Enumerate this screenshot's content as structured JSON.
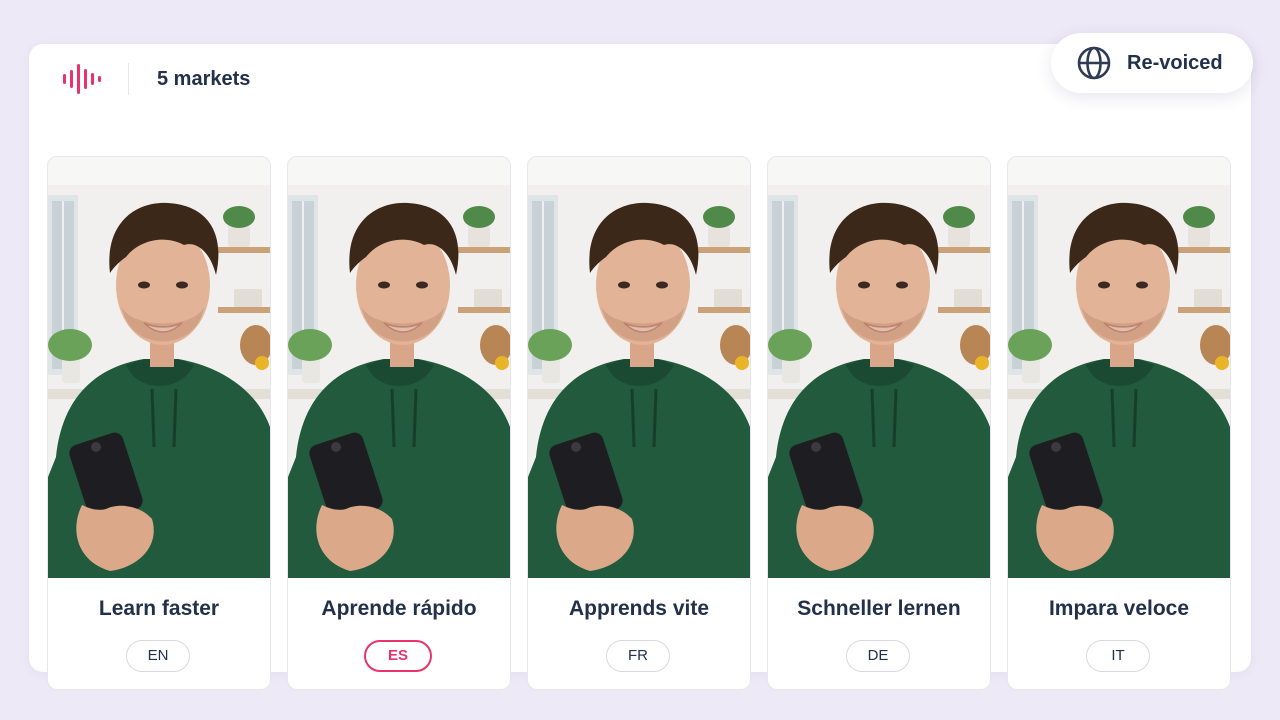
{
  "header": {
    "markets_label": "5 markets",
    "badge_label": "Re-voiced",
    "badge_icon": "globe-icon",
    "brand_icon": "audio-wave-icon"
  },
  "colors": {
    "accent": "#E8336D",
    "text": "#22304A",
    "background": "#EDE9F7"
  },
  "cards": [
    {
      "caption": "Learn faster",
      "lang": "EN",
      "active": false
    },
    {
      "caption": "Aprende rápido",
      "lang": "ES",
      "active": true
    },
    {
      "caption": "Apprends vite",
      "lang": "FR",
      "active": false
    },
    {
      "caption": "Schneller lernen",
      "lang": "DE",
      "active": false
    },
    {
      "caption": "Impara veloce",
      "lang": "IT",
      "active": false
    }
  ]
}
